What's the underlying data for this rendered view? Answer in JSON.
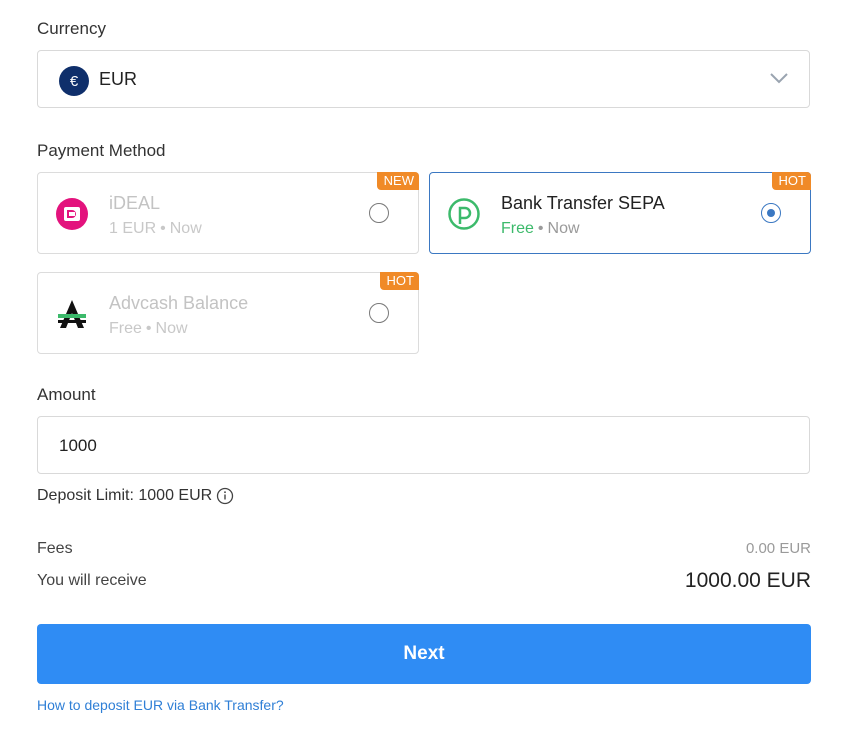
{
  "currency": {
    "label": "Currency",
    "symbol": "€",
    "selected": "EUR",
    "icon": "chevron-down-icon"
  },
  "payment_method": {
    "label": "Payment Method",
    "options": [
      {
        "name": "iDEAL",
        "fee": "1 EUR",
        "time": "Now",
        "badge": "NEW",
        "selected": false,
        "enabled": false,
        "icon": "ideal-logo-icon"
      },
      {
        "name": "Bank Transfer SEPA",
        "fee": "Free",
        "time": "Now",
        "badge": "HOT",
        "selected": true,
        "enabled": true,
        "icon": "sepa-logo-icon"
      },
      {
        "name": "Advcash Balance",
        "fee": "Free",
        "time": "Now",
        "badge": "HOT",
        "selected": false,
        "enabled": false,
        "icon": "advcash-logo-icon"
      }
    ],
    "separator": "•"
  },
  "amount": {
    "label": "Amount",
    "value": "1000"
  },
  "deposit_limit": {
    "text": "Deposit Limit: 1000 EUR",
    "icon": "info-icon"
  },
  "summary": {
    "fees_label": "Fees",
    "fees_value": "0.00 EUR",
    "receive_label": "You will receive",
    "receive_value": "1000.00 EUR"
  },
  "actions": {
    "next_label": "Next",
    "help_link": "How to deposit EUR via Bank Transfer?"
  },
  "colors": {
    "primary": "#2f8cf4",
    "badge": "#f08a27",
    "free_green": "#3cba6b",
    "selected_border": "#3b78c2"
  }
}
